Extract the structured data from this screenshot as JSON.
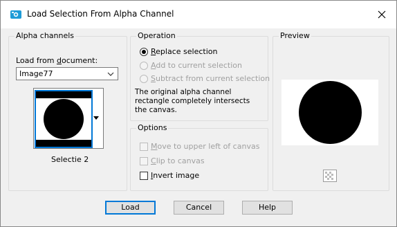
{
  "window": {
    "title": "Load Selection From Alpha Channel"
  },
  "alpha_channels": {
    "group_title": "Alpha channels",
    "load_from_label": "Load from document:",
    "document_value": "Image77",
    "channel_name": "Selectie 2"
  },
  "operation": {
    "group_title": "Operation",
    "replace": {
      "label": "Replace selection",
      "selected": true,
      "enabled": true
    },
    "add": {
      "label": "Add to current selection",
      "selected": false,
      "enabled": false
    },
    "subtract": {
      "label": "Subtract from current selection",
      "selected": false,
      "enabled": false
    },
    "description": "The original alpha channel rectangle completely intersects the canvas."
  },
  "options": {
    "group_title": "Options",
    "move_upper_left": {
      "label": "Move to upper left of canvas",
      "checked": false,
      "enabled": false
    },
    "clip_to_canvas": {
      "label": "Clip to canvas",
      "checked": false,
      "enabled": false
    },
    "invert_image": {
      "label": "Invert image",
      "checked": false,
      "enabled": true
    }
  },
  "preview": {
    "group_title": "Preview"
  },
  "buttons": {
    "load": "Load",
    "cancel": "Cancel",
    "help": "Help"
  },
  "icons": {
    "app": "load-selection-app-icon",
    "close": "close-icon",
    "chevron": "chevron-down-icon",
    "dropdown_arrow": "dropdown-arrow-icon",
    "transparency": "transparency-checker-icon"
  },
  "colors": {
    "accent": "#0078d7",
    "app_icon": "#1e9bd7"
  }
}
